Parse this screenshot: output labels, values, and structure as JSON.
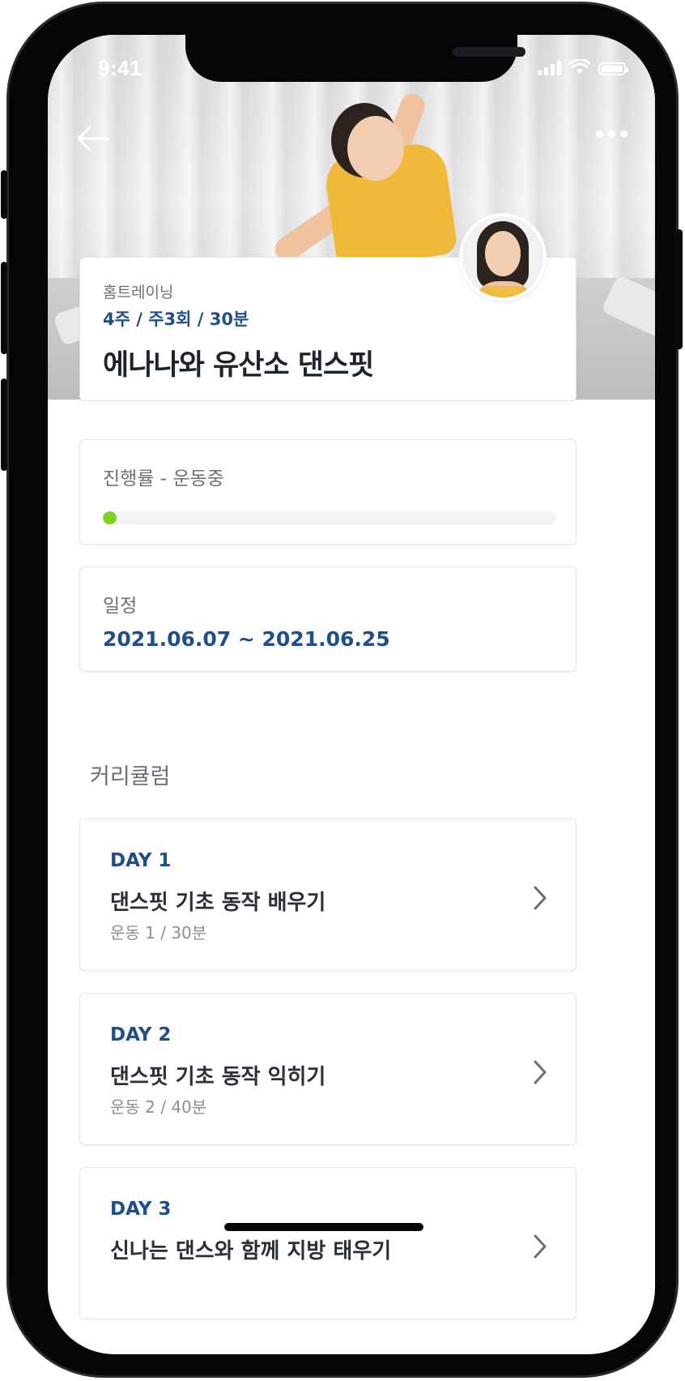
{
  "status_bar": {
    "time": "9:41"
  },
  "header": {
    "back_icon": "arrow-left-icon",
    "more_icon": "more-horizontal-icon"
  },
  "program": {
    "category": "홈트레이닝",
    "schedule_tag": "4주 / 주3회 / 30분",
    "title": "에나나와 유산소 댄스핏"
  },
  "progress": {
    "label": "진행률 - 운동중",
    "value": 0.03,
    "color": "#7ed321"
  },
  "schedule": {
    "label": "일정",
    "dates": "2021.06.07 ~ 2021.06.25"
  },
  "curriculum": {
    "heading": "커리큘럼",
    "days": [
      {
        "day": "DAY 1",
        "title": "댄스핏 기초 동작 배우기",
        "sub": "운동 1 / 30분"
      },
      {
        "day": "DAY 2",
        "title": "댄스핏 기초 동작 익히기",
        "sub": "운동 2 / 40분"
      },
      {
        "day": "DAY 3",
        "title": "신나는 댄스와 함께 지방 태우기",
        "sub": ""
      }
    ]
  },
  "colors": {
    "accent": "#1f4e8c",
    "progress": "#7ed321",
    "text_primary": "#1e2330",
    "text_secondary": "#6b6f76"
  }
}
